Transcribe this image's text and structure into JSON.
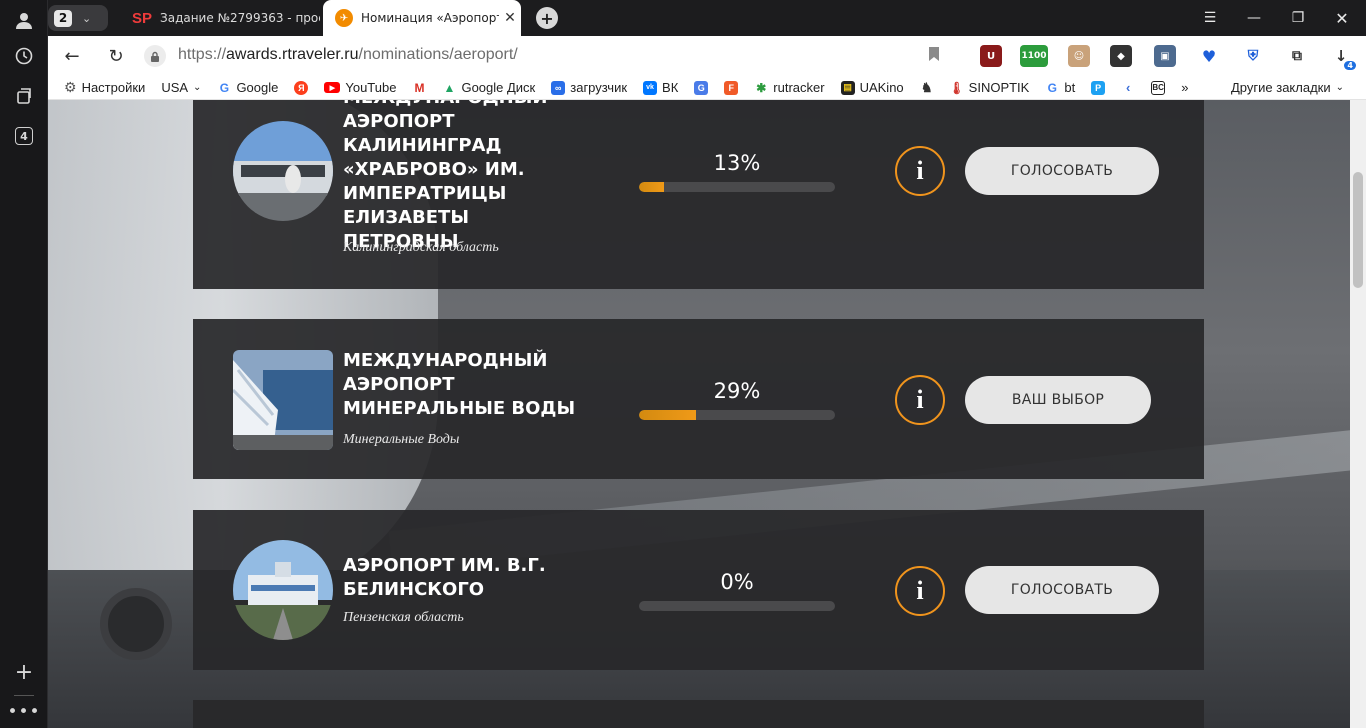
{
  "browser": {
    "tab_count": "2",
    "tabs": [
      {
        "title": "Задание №2799363 - прос",
        "favicon": "SP"
      },
      {
        "title": "Номинация «Аэропорт"
      }
    ],
    "url_prefix": "https://",
    "url_host": "awards.rtraveler.ru",
    "url_path": "/nominations/aeroport/",
    "sidebar_badge": "4",
    "download_badge": "4",
    "extension_label": "1100"
  },
  "bookmarks": [
    {
      "label": "Настройки",
      "icon": "gear-icon",
      "color": "#555555"
    },
    {
      "label": "USA",
      "icon": "",
      "color": "",
      "dropdown": true
    },
    {
      "label": "Google",
      "icon": "google-icon",
      "color": "#4285f4"
    },
    {
      "label": "",
      "icon": "yandex-icon",
      "color": "#fc3f1d"
    },
    {
      "label": "YouTube",
      "icon": "youtube-icon",
      "color": "#ff0000"
    },
    {
      "label": "",
      "icon": "gmail-icon",
      "color": "#d93025"
    },
    {
      "label": "Google Диск",
      "icon": "google-drive-icon",
      "color": "#1fa463"
    },
    {
      "label": "загрузчик",
      "icon": "infinity-icon",
      "color": "#2a6ee8"
    },
    {
      "label": "ВК",
      "icon": "vk-icon",
      "color": "#0077ff"
    },
    {
      "label": "",
      "icon": "translate-icon",
      "color": "#4a7be8"
    },
    {
      "label": "",
      "icon": "f-icon",
      "color": "#f05a28"
    },
    {
      "label": "rutracker",
      "icon": "rutracker-icon",
      "color": "#2d9c3f"
    },
    {
      "label": "UAKino",
      "icon": "uakino-icon",
      "color": "#222222"
    },
    {
      "label": "",
      "icon": "chess-knight-icon",
      "color": "#333333"
    },
    {
      "label": "SINOPTIK",
      "icon": "thermometer-icon",
      "color": "#d0342c"
    },
    {
      "label": "bt",
      "icon": "g-icon",
      "color": "#4285f4"
    },
    {
      "label": "",
      "icon": "p-icon",
      "color": "#1da1f2"
    },
    {
      "label": "",
      "icon": "arrow-left-icon",
      "color": "#3c6fd8"
    },
    {
      "label": "",
      "icon": "bc-icon",
      "color": "#222222"
    }
  ],
  "bookmarks_more": "»",
  "bookmarks_other": "Другие закладки",
  "nominees": [
    {
      "name": "Международный аэропорт Калининград «Храброво» им. Императрицы Елизаветы Петровны",
      "region": "Калининградская область",
      "percent_label": "13%",
      "percent": 13,
      "button": "ГОЛОСОВАТЬ",
      "photo_colors": [
        "#5b8fcf",
        "#cfd6dc",
        "#6b6f73"
      ]
    },
    {
      "name": "Международный аэропорт Минеральные Воды",
      "region": "Минеральные Воды",
      "percent_label": "29%",
      "percent": 29,
      "button": "ВАШ ВЫБОР",
      "photo_colors": [
        "#3f6fa8",
        "#e8eef4",
        "#8ba3bf"
      ]
    },
    {
      "name": "Аэропорт им. В.Г. Белинского",
      "region": "Пензенская область",
      "percent_label": "0%",
      "percent": 0,
      "button": "ГОЛОСОВАТЬ",
      "photo_colors": [
        "#8fb6e0",
        "#6c8fb4",
        "#4f6a3f"
      ]
    }
  ],
  "colors": {
    "accent": "#f0941d",
    "card_bg": "#28282a",
    "button_bg": "#e6e6e6"
  }
}
